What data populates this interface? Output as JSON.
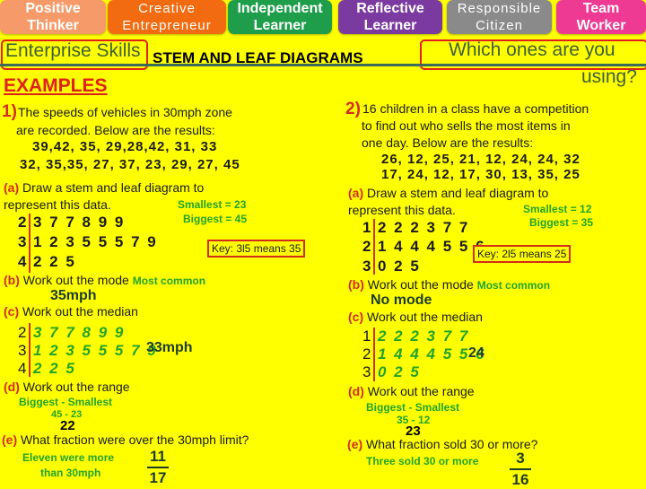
{
  "header": {
    "skills": [
      {
        "line1": "Positive",
        "line2": "Thinker"
      },
      {
        "line1": "Creative",
        "line2": "Entrepreneur"
      },
      {
        "line1": "Independent",
        "line2": "Learner"
      },
      {
        "line1": "Reflective",
        "line2": "Learner"
      },
      {
        "line1": "Responsible",
        "line2": "Citizen"
      },
      {
        "line1": "Team",
        "line2": "Worker"
      }
    ],
    "enterprise_label": "Enterprise Skills",
    "title": "STEM AND LEAF DIAGRAMS",
    "which_line1": "Which ones are you",
    "which_line2": "using?",
    "examples": "EXAMPLES"
  },
  "q1": {
    "number": "1)",
    "intro1": "The speeds of vehicles in 30mph zone",
    "intro2": "are recorded. Below are the results:",
    "data_line1": "39,42, 35, 29,28,42, 31, 33",
    "data_line2": "32, 35,35, 27, 37, 23, 29, 27, 45",
    "a_label": "(a)",
    "a_text1": "Draw a stem and leaf diagram to",
    "a_text2": "represent this data.",
    "smallest": "Smallest = 23",
    "biggest": "Biggest = 45",
    "stems": [
      "2",
      "3",
      "4"
    ],
    "leaves": [
      "3 7 7 8 9 9",
      "1 2 3 5 5 5 7 9",
      "2 2 5"
    ],
    "key": "Key: 3l5 means 35",
    "b_label": "(b)",
    "b_text": "Work out the mode",
    "b_hint": "Most common",
    "b_answer": "35mph",
    "c_label": "(c)",
    "c_text": "Work out the median",
    "c_answer": "33mph",
    "d_label": "(d)",
    "d_text": "Work out the range",
    "d_hint1": "Biggest - Smallest",
    "d_hint2": "45 - 23",
    "d_answer": "22",
    "e_label": "(e)",
    "e_text": "What fraction were over the 30mph limit?",
    "e_hint1": "Eleven were more",
    "e_hint2": "than 30mph",
    "e_num": "11",
    "e_den": "17"
  },
  "q2": {
    "number": "2)",
    "intro1": "16 children in a class have a competition",
    "intro2": "to find out who sells the most items in",
    "intro3": "one day. Below are the results:",
    "data_line1": "26, 12, 25, 21, 12, 24, 24, 32",
    "data_line2": "17, 24, 12, 17, 30, 13, 35, 25",
    "a_label": "(a)",
    "a_text1": "Draw a stem and leaf diagram to",
    "a_text2": "represent this data.",
    "smallest": "Smallest = 12",
    "biggest": "Biggest = 35",
    "stems": [
      "1",
      "2",
      "3"
    ],
    "leaves": [
      "2 2 2 3 7 7",
      "1 4 4 4 5 5 6",
      "0 2 5"
    ],
    "key": "Key: 2l5 means 25",
    "b_label": "(b)",
    "b_text": "Work out the mode",
    "b_hint": "Most common",
    "b_answer": "No mode",
    "c_label": "(c)",
    "c_text": "Work out the median",
    "c_answer": "24",
    "d_label": "(d)",
    "d_text": "Work out the range",
    "d_hint1": "Biggest - Smallest",
    "d_hint2": "35 - 12",
    "d_answer": "23",
    "e_label": "(e)",
    "e_text": "What fraction sold 30 or more?",
    "e_hint1": "Three sold 30 or more",
    "e_num": "3",
    "e_den": "16"
  },
  "colors": {
    "background": "#ffff00",
    "label_red": "#d42b1b",
    "hint_green": "#22a22a"
  }
}
